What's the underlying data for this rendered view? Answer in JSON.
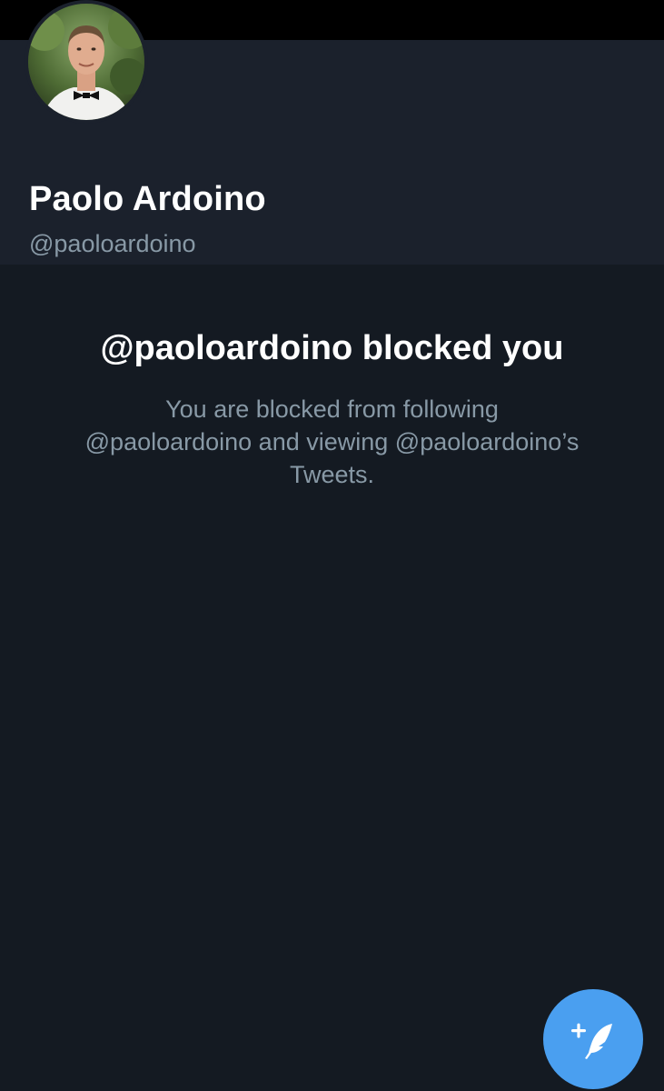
{
  "profile": {
    "display_name": "Paolo Ardoino",
    "handle": "@paoloardoino"
  },
  "blocked_notice": {
    "title": "@paoloardoino blocked you",
    "body_lines": [
      "You are blocked from following",
      "@paoloardoino and viewing @paoloardoino’s",
      "Tweets."
    ]
  },
  "icons": {
    "avatar": "profile-photo",
    "compose": "compose-tweet-icon"
  },
  "colors": {
    "background": "#141a22",
    "header_background": "#1b212c",
    "primary_text": "#ffffff",
    "secondary_text": "#8899a6",
    "accent": "#4a9ff0"
  }
}
